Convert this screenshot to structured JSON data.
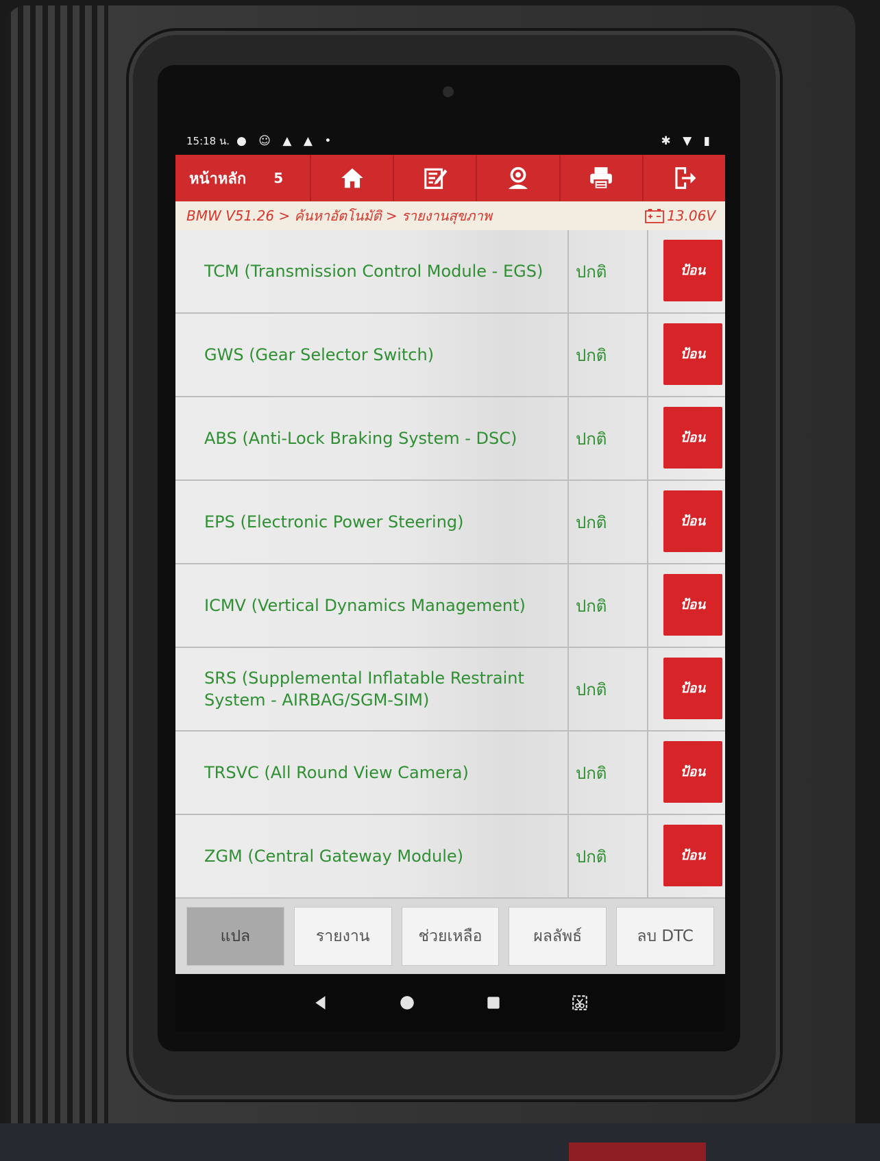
{
  "status_bar": {
    "time": "15:18 น."
  },
  "toolbar": {
    "title": "หน้าหลัก",
    "page_num": "5",
    "buttons": [
      {
        "icon": "home-icon"
      },
      {
        "icon": "edit-icon"
      },
      {
        "icon": "support-user-icon"
      },
      {
        "icon": "print-icon"
      },
      {
        "icon": "exit-icon"
      }
    ]
  },
  "breadcrumb": {
    "path": "BMW V51.26 > ค้นหาอัตโนมัติ > รายงานสุขภาพ",
    "voltage": "13.06V"
  },
  "rows": [
    {
      "system": "TCM (Transmission Control Module - EGS)",
      "status": "ปกติ",
      "action": "ป้อน"
    },
    {
      "system": "GWS (Gear Selector Switch)",
      "status": "ปกติ",
      "action": "ป้อน"
    },
    {
      "system": "ABS (Anti-Lock Braking System - DSC)",
      "status": "ปกติ",
      "action": "ป้อน"
    },
    {
      "system": "EPS (Electronic Power Steering)",
      "status": "ปกติ",
      "action": "ป้อน"
    },
    {
      "system": "ICMV (Vertical Dynamics Management)",
      "status": "ปกติ",
      "action": "ป้อน"
    },
    {
      "system": "SRS (Supplemental Inflatable Restraint System - AIRBAG/SGM-SIM)",
      "status": "ปกติ",
      "action": "ป้อน"
    },
    {
      "system": "TRSVC (All Round View Camera)",
      "status": "ปกติ",
      "action": "ป้อน"
    },
    {
      "system": "ZGM (Central Gateway Module)",
      "status": "ปกติ",
      "action": "ป้อน"
    }
  ],
  "bottom_buttons": [
    {
      "label": "แปล",
      "active": true
    },
    {
      "label": "รายงาน"
    },
    {
      "label": "ช่วยเหลือ"
    },
    {
      "label": "ผลลัพธ์"
    },
    {
      "label": "ลบ DTC"
    }
  ],
  "colors": {
    "toolbar_red": "#cf2a2c",
    "text_green": "#2f8f33",
    "enter_button_red": "#d62428",
    "breadcrumb_text": "#d8362d"
  }
}
